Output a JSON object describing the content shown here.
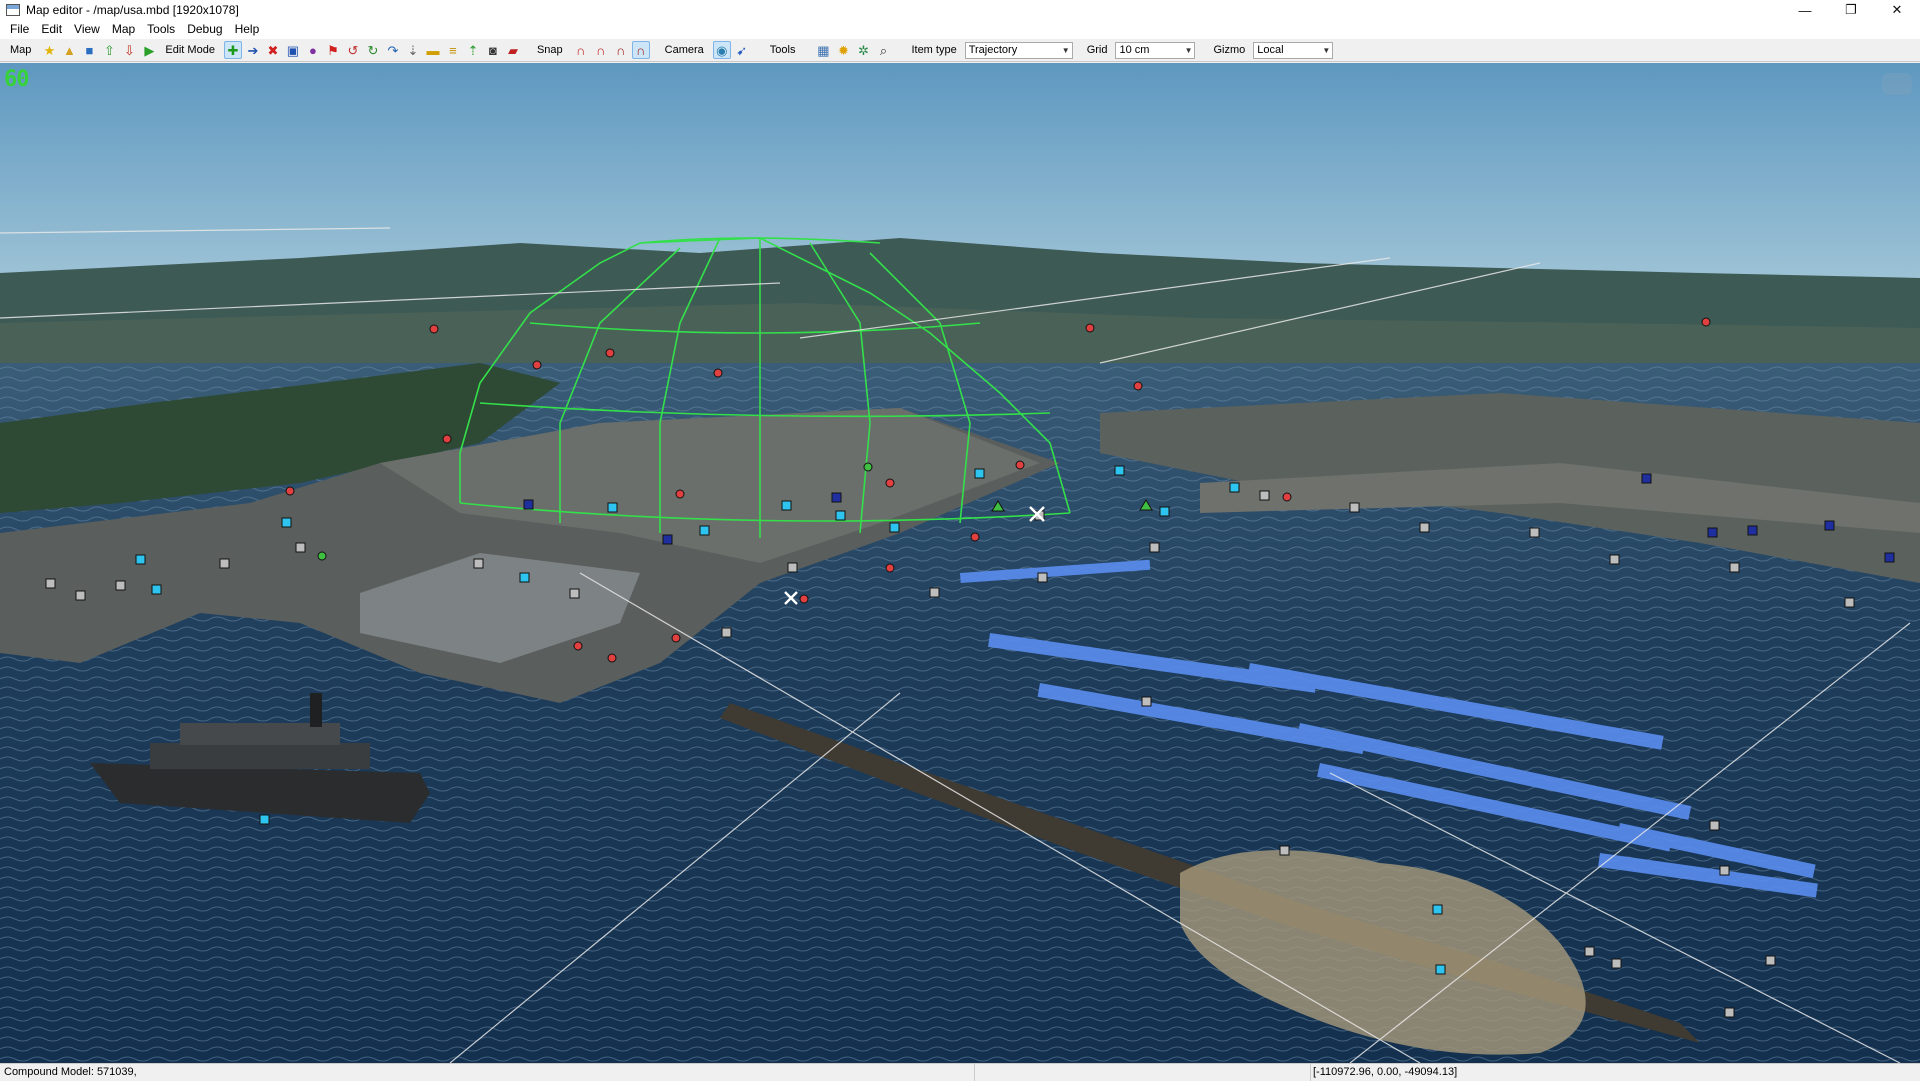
{
  "window": {
    "title": "Map editor - /map/usa.mbd [1920x1078]",
    "controls": {
      "minimize": "—",
      "maximize": "❐",
      "close": "✕"
    }
  },
  "menu": {
    "items": [
      "File",
      "Edit",
      "View",
      "Map",
      "Tools",
      "Debug",
      "Help"
    ]
  },
  "toolbar": {
    "map_label": "Map",
    "edit_mode_label": "Edit Mode",
    "snap_label": "Snap",
    "camera_label": "Camera",
    "tools_label": "Tools",
    "item_type_label": "Item type",
    "item_type_value": "Trajectory",
    "grid_label": "Grid",
    "grid_value": "10 cm",
    "gizmo_label": "Gizmo",
    "gizmo_value": "Local"
  },
  "viewport": {
    "fps": "60"
  },
  "status": {
    "selection": "Compound Model: 571039,",
    "coordinates": "[-110972.96, 0.00, -49094.13]"
  },
  "icons": {
    "map_tools": [
      {
        "name": "star-icon",
        "glyph": "★",
        "color": "#e0b400"
      },
      {
        "name": "open-folder-icon",
        "glyph": "▲",
        "color": "#d4a020"
      },
      {
        "name": "save-icon",
        "glyph": "■",
        "color": "#2a6fc0"
      },
      {
        "name": "upload-icon",
        "glyph": "⇧",
        "color": "#2c9a2c"
      },
      {
        "name": "download-icon",
        "glyph": "⇩",
        "color": "#c03020"
      },
      {
        "name": "play-icon",
        "glyph": "▶",
        "color": "#2aa02a"
      }
    ],
    "edit_tools": [
      {
        "name": "add-icon",
        "glyph": "✚",
        "color": "#1c9a1c"
      },
      {
        "name": "arrow-right-icon",
        "glyph": "➔",
        "color": "#2050b0"
      },
      {
        "name": "delete-icon",
        "glyph": "✖",
        "color": "#d02020"
      },
      {
        "name": "properties-icon",
        "glyph": "▣",
        "color": "#2050b0"
      },
      {
        "name": "help-icon",
        "glyph": "●",
        "color": "#8030a0"
      },
      {
        "name": "flag-icon",
        "glyph": "⚑",
        "color": "#d02020"
      },
      {
        "name": "rotate-icon",
        "glyph": "↺",
        "color": "#c03030"
      },
      {
        "name": "refresh-icon",
        "glyph": "↻",
        "color": "#2a8a2a"
      },
      {
        "name": "redo-icon",
        "glyph": "↷",
        "color": "#2060b0"
      },
      {
        "name": "move-down-icon",
        "glyph": "⇣",
        "color": "#666"
      },
      {
        "name": "level-icon",
        "glyph": "▬",
        "color": "#d0a000"
      },
      {
        "name": "align-icon",
        "glyph": "≡",
        "color": "#c09000"
      },
      {
        "name": "move-up-icon",
        "glyph": "⇡",
        "color": "#2a9a2a"
      },
      {
        "name": "film-icon",
        "glyph": "◙",
        "color": "#333"
      },
      {
        "name": "truck-icon",
        "glyph": "▰",
        "color": "#c02020"
      }
    ],
    "snap_tools": [
      {
        "name": "magnet-icon",
        "glyph": "∩",
        "color": "#c02020"
      },
      {
        "name": "magnet-point-icon",
        "glyph": "∩",
        "color": "#c02020"
      },
      {
        "name": "magnet-edge-icon",
        "glyph": "∩",
        "color": "#a02020"
      },
      {
        "name": "magnet-grid-icon",
        "glyph": "∩",
        "color": "#a02020"
      }
    ],
    "camera_tools": [
      {
        "name": "camera-orbit-icon",
        "glyph": "◉",
        "color": "#2a7fb0"
      },
      {
        "name": "camera-fly-icon",
        "glyph": "➹",
        "color": "#2a5fc0"
      }
    ],
    "misc_tools": [
      {
        "name": "layers-icon",
        "glyph": "▦",
        "color": "#3a70b0"
      },
      {
        "name": "sun-icon",
        "glyph": "✹",
        "color": "#e0a000"
      },
      {
        "name": "gear-icon",
        "glyph": "✲",
        "color": "#2a8a4a"
      },
      {
        "name": "search-icon",
        "glyph": "⌕",
        "color": "#333"
      }
    ]
  }
}
